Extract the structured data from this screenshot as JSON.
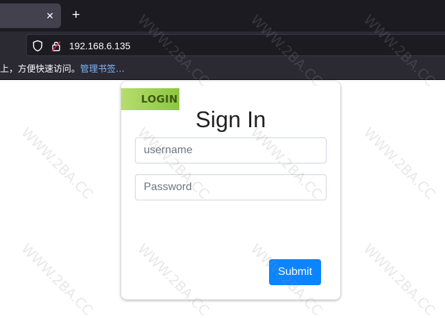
{
  "browser": {
    "tab_close_glyph": "✕",
    "new_tab_glyph": "+",
    "url": "192.168.6.135",
    "bookmarks_text": "上，方便快速访问。",
    "bookmarks_link": "管理书签…"
  },
  "login": {
    "ribbon_label": "LOGIN",
    "title": "Sign In",
    "username_placeholder": "username",
    "password_placeholder": "Password",
    "submit_label": "Submit"
  },
  "watermark": {
    "text": "WWW.2BA.CC"
  },
  "colors": {
    "ribbon": "#8cc63e",
    "submit": "#0b84ff"
  }
}
